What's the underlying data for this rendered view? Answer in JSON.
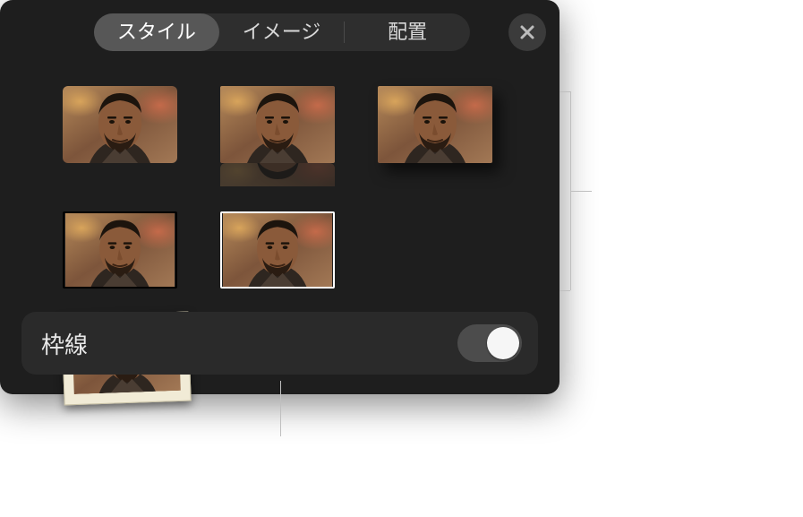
{
  "tabs": {
    "style": "スタイル",
    "image": "イメージ",
    "arrange": "配置"
  },
  "style_thumbs": [
    {
      "name": "style-none"
    },
    {
      "name": "style-reflection"
    },
    {
      "name": "style-shadow"
    },
    {
      "name": "style-black-border"
    },
    {
      "name": "style-white-border"
    },
    {
      "name": "style-mat-frame"
    }
  ],
  "border": {
    "label": "枠線",
    "on": true
  },
  "icons": {
    "close": "close-icon"
  }
}
